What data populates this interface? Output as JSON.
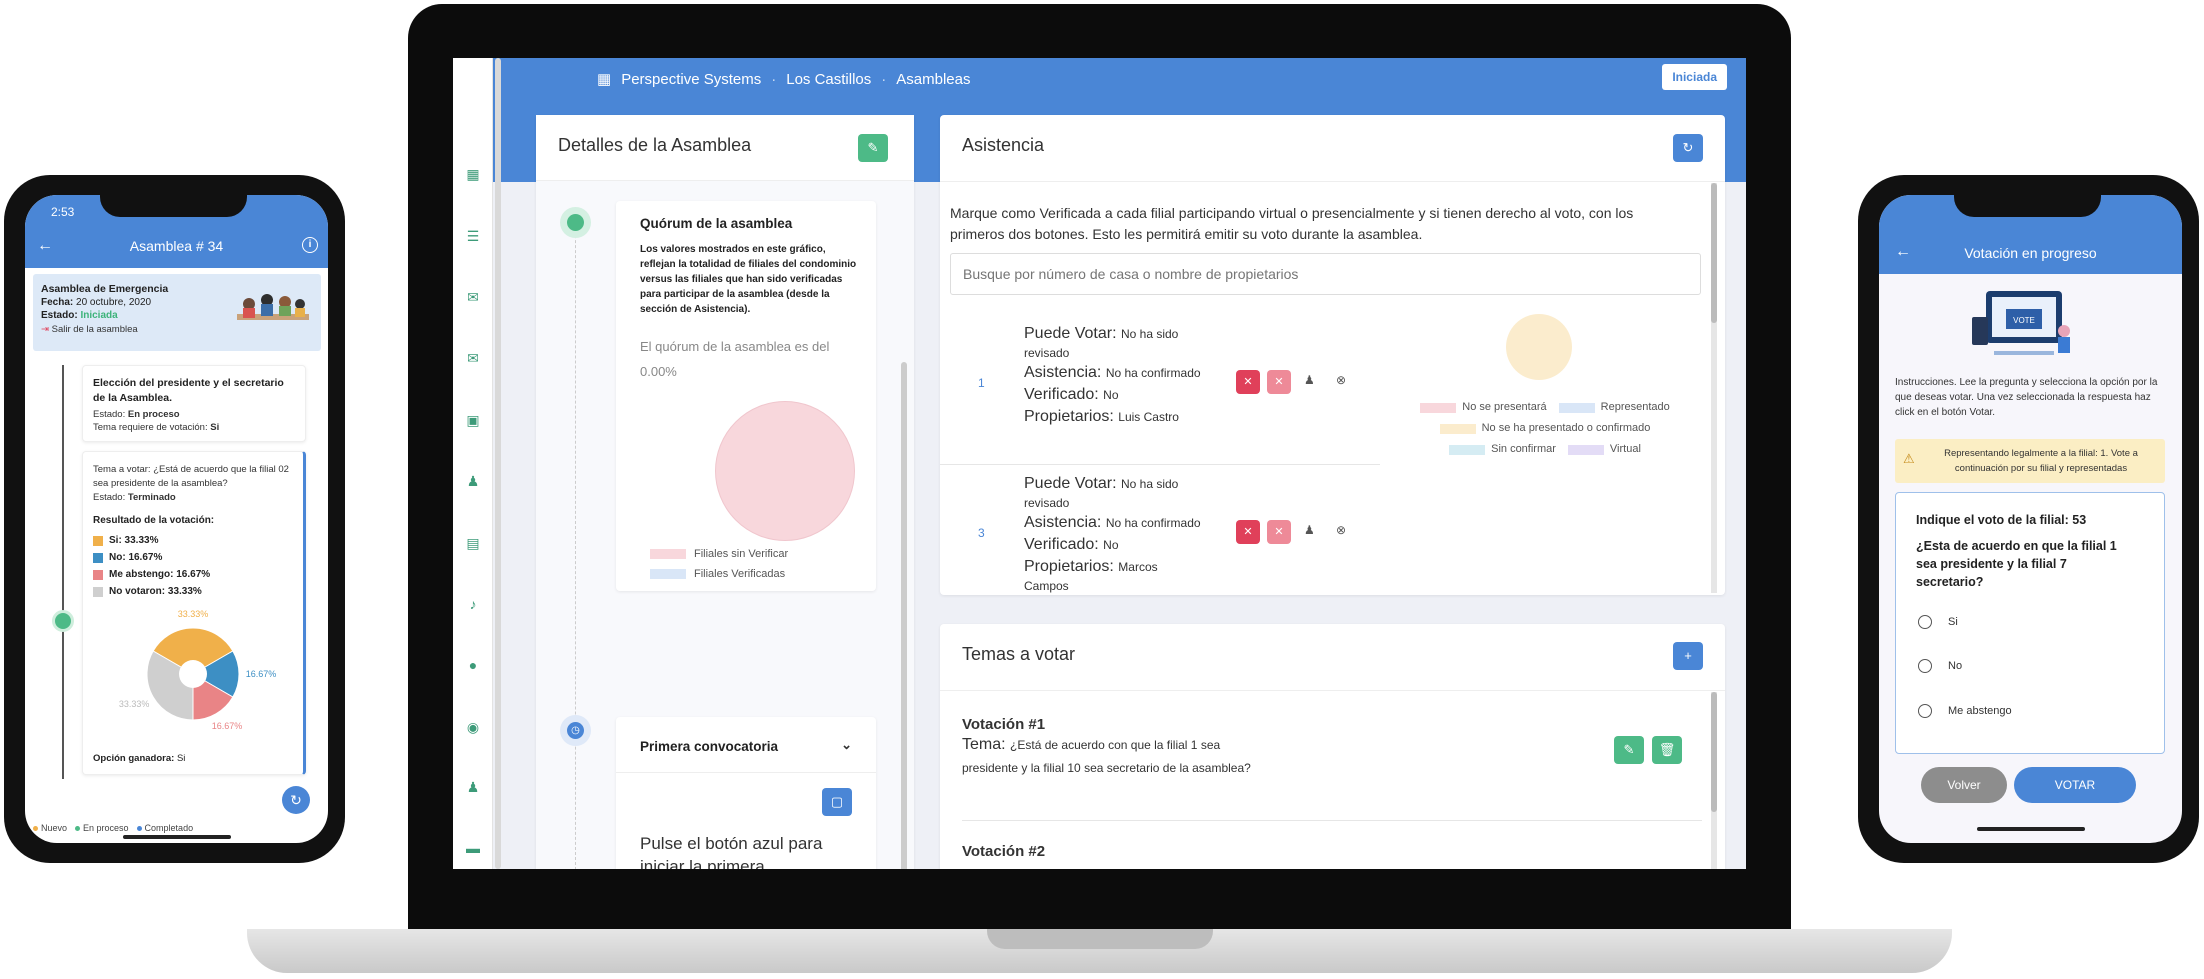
{
  "laptop": {
    "breadcrumb": [
      "Perspective Systems",
      "Los Castillos",
      "Asambleas"
    ],
    "status_badge": "Iniciada",
    "details": {
      "title": "Detalles de la Asamblea",
      "quorum_title": "Quórum de la asamblea",
      "quorum_desc": "Los valores mostrados en este gráfico, reflejan la totalidad de filiales del condominio versus las filiales que han sido verificadas para participar de la asamblea (desde la sección de Asistencia).",
      "quorum_text": "El quórum de la asamblea es del",
      "quorum_value": "0.00%",
      "legend": [
        "Filiales sin Verificar",
        "Filiales Verificadas"
      ],
      "legend_colors": [
        "#f8d7dc",
        "#d9e6f7"
      ],
      "convocatoria": "Primera convocatoria",
      "convocatoria_text": "Pulse el botón azul para iniciar la primera convocatoria. Primera convocatoria configurada"
    },
    "attendance": {
      "title": "Asistencia",
      "instructions": "Marque como Verificada a cada filial participando virtual o presencialmente y si tienen derecho al voto, con los primeros dos botones. Esto les permitirá emitir su voto durante la asamblea.",
      "search_placeholder": "Busque por número de casa o nombre de propietarios",
      "rows": [
        {
          "num": "1",
          "puede_label": "Puede Votar:",
          "puede": "No ha sido",
          "puede2": "revisado",
          "asis_label": "Asistencia:",
          "asis": "No ha confirmado",
          "ver_label": "Verificado:",
          "ver": "No",
          "prop_label": "Propietarios:",
          "prop": "Luis Castro",
          "prop2": ""
        },
        {
          "num": "3",
          "puede_label": "Puede Votar:",
          "puede": "No ha sido",
          "puede2": "revisado",
          "asis_label": "Asistencia:",
          "asis": "No ha confirmado",
          "ver_label": "Verificado:",
          "ver": "No",
          "prop_label": "Propietarios:",
          "prop": "Marcos",
          "prop2": "Campos"
        }
      ],
      "legend": [
        "No se presentará",
        "Representado",
        "No se ha presentado o confirmado",
        "Sin confirmar",
        "Virtual"
      ],
      "legend_colors": [
        "#f8d7dc",
        "#d9e6f7",
        "#fbeccd",
        "#d5ecf3",
        "#e3dcf6"
      ]
    },
    "topics": {
      "title": "Temas a votar",
      "items": [
        {
          "title": "Votación #1",
          "tema_label": "Tema:",
          "tema": "¿Está de acuerdo con que la filial 1 sea presidente y la filial 10 sea secretario de la asamblea?"
        },
        {
          "title": "Votación #2"
        }
      ]
    }
  },
  "phone_left": {
    "time": "2:53",
    "title": "Asamblea # 34",
    "event": {
      "name": "Asamblea de Emergencia",
      "fecha_label": "Fecha:",
      "fecha": "20 octubre, 2020",
      "estado_label": "Estado:",
      "estado": "Iniciada",
      "exit": "Salir de la asamblea"
    },
    "item1": {
      "title": "Elección del presidente y el secretario de la Asamblea.",
      "estado_label": "Estado:",
      "estado": "En proceso",
      "req_label": "Tema requiere de votación:",
      "req": "Si"
    },
    "item2": {
      "tema": "Tema a votar: ¿Está de acuerdo que la filial 02 sea presidente de la asamblea?",
      "estado_label": "Estado:",
      "estado": "Terminado",
      "result_title": "Resultado de la votación:",
      "results": [
        {
          "label": "Si: 33.33%",
          "color": "#f0b04a"
        },
        {
          "label": "No: 16.67%",
          "color": "#3d8fc4"
        },
        {
          "label": "Me abstengo: 16.67%",
          "color": "#e98486"
        },
        {
          "label": "No votaron: 33.33%",
          "color": "#cfcfcf"
        }
      ],
      "winner_label": "Opción ganadora:",
      "winner": "Si"
    },
    "chart_data": {
      "type": "pie",
      "categories": [
        "Si",
        "No",
        "Me abstengo",
        "No votaron"
      ],
      "values": [
        33.33,
        16.67,
        16.67,
        33.33
      ],
      "labels": [
        "33.33%",
        "16.67%",
        "16.67%",
        "33.33%"
      ],
      "colors": [
        "#f0b04a",
        "#3d8fc4",
        "#e98486",
        "#cfcfcf"
      ]
    },
    "legend": [
      "Nuevo",
      "En proceso",
      "Completado"
    ],
    "legend_colors": [
      "#f0b04a",
      "#4dba87",
      "#4a86d6"
    ]
  },
  "phone_right": {
    "title": "Votación en progreso",
    "instructions": "Instrucciones. Lee la pregunta y selecciona la opción por la que deseas votar. Una vez seleccionada la respuesta haz click en el botón Votar.",
    "warning": "Representando legalmente a la filial: 1. Vote a continuación por su filial y representadas",
    "vote_title": "Indique el voto de la filial: 53",
    "question": "¿Esta de acuerdo en que la filial 1 sea presidente y la filial 7 secretario?",
    "options": [
      "Si",
      "No",
      "Me abstengo"
    ],
    "back": "Volver",
    "vote": "VOTAR",
    "illustration": "VOTE"
  }
}
